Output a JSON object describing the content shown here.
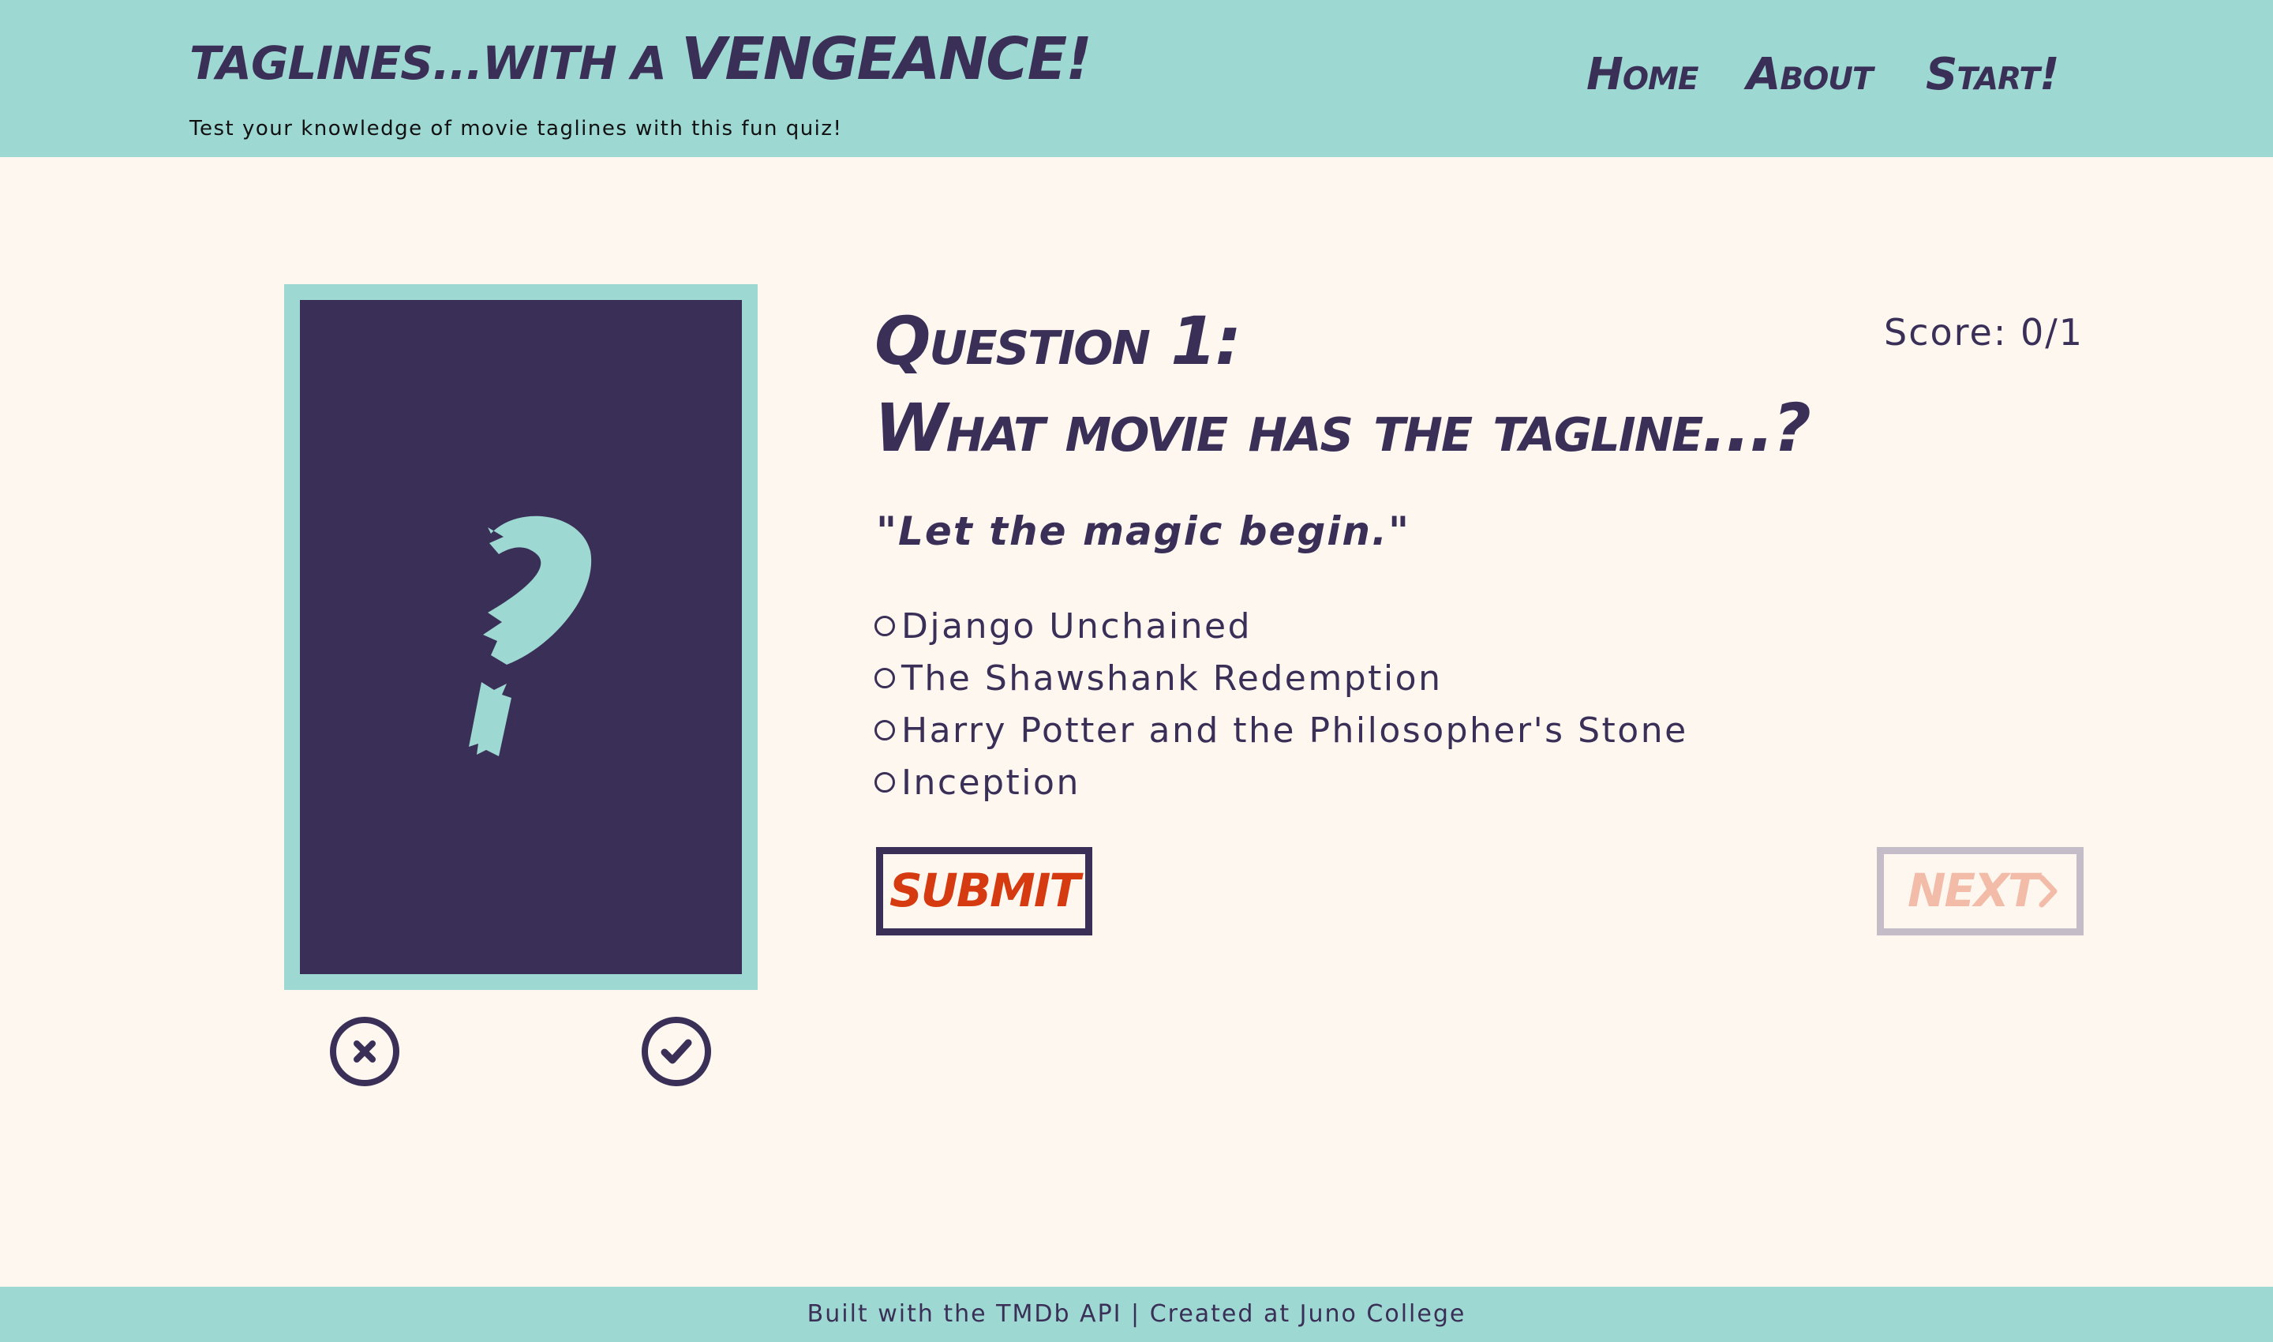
{
  "header": {
    "logo_part1": "TAGLINES...WITH A ",
    "logo_part2": "VENGEANCE!",
    "subtitle": "Test your knowledge of movie taglines with this fun quiz!",
    "nav": {
      "home": "Home",
      "about": "About",
      "start": "Start!"
    }
  },
  "poster": {
    "icon": "question-mark-icon"
  },
  "answer_controls": {
    "wrong_icon": "x-circle-icon",
    "right_icon": "check-circle-icon"
  },
  "quiz": {
    "question_label": "Question 1:",
    "question_text": "What movie has the tagline...?",
    "score": "Score: 0/1",
    "tagline": "\"Let the magic begin.\"",
    "options": [
      "Django Unchained",
      "The Shawshank Redemption",
      "Harry Potter and the Philosopher's Stone",
      "Inception"
    ],
    "submit_label": "SUBMIT",
    "next_label": "NEXT",
    "next_icon": "chevron-right-icon"
  },
  "footer": {
    "text": "Built with the TMDb API | Created at Juno College"
  },
  "colors": {
    "header_bg": "#9ed8d2",
    "page_bg": "#fdf7f0",
    "primary": "#3a2f57",
    "submit_text": "#d63a10",
    "next_text_disabled": "#f2bca8",
    "next_border_disabled": "#c4bcc6"
  }
}
